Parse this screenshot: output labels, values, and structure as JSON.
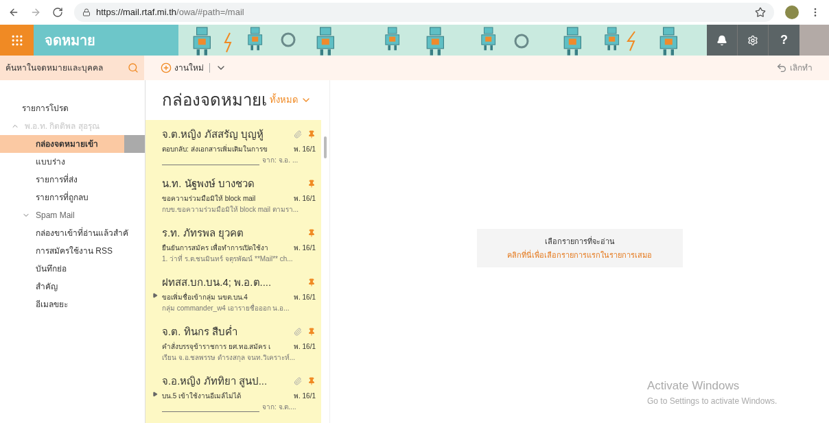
{
  "browser": {
    "url_host": "https://mail.rtaf.mi.th",
    "url_path": "/owa/#path=/mail"
  },
  "header": {
    "app_title": "จดหมาย",
    "help_label": "?"
  },
  "search": {
    "placeholder": "ค้นหาในจดหมายและบุคคล"
  },
  "commands": {
    "new": "งานใหม่",
    "undo": "เลิกทำ"
  },
  "sidebar": {
    "favorites": "รายการโปรด",
    "account": {
      "name": "พ.อ.ท. กิตติพล สุอรุณ",
      "expanded": true
    },
    "items": [
      {
        "label": "กล่องจดหมายเข้า",
        "selected": true,
        "kind": "folder"
      },
      {
        "label": "แบบร่าง",
        "selected": false,
        "kind": "folder"
      },
      {
        "label": "รายการที่ส่ง",
        "selected": false,
        "kind": "folder"
      },
      {
        "label": "รายการที่ถูกลบ",
        "selected": false,
        "kind": "folder"
      },
      {
        "label": "Spam Mail",
        "selected": false,
        "kind": "group",
        "expanded": true
      },
      {
        "label": "กล่องขาเข้าที่อ่านแล้วสำคั",
        "selected": false,
        "kind": "folder"
      },
      {
        "label": "การสมัครใช้งาน RSS",
        "selected": false,
        "kind": "folder"
      },
      {
        "label": "บันทึกย่อ",
        "selected": false,
        "kind": "folder"
      },
      {
        "label": "สำคัญ",
        "selected": false,
        "kind": "folder"
      },
      {
        "label": "อีเมลขยะ",
        "selected": false,
        "kind": "folder"
      }
    ]
  },
  "list": {
    "title": "กล่องจดหมายเ",
    "filter": "ทั้งหมด",
    "messages": [
      {
        "sender": "จ.ต.หญิง ภัสสรัญ บุญหู้",
        "subject": "ตอบกลับ: ส่งเอกสารเพิ่มเติมในการข",
        "date": "พ. 16/1",
        "preview": "จาก: จ.อ. ...",
        "preview_rule": true,
        "attachment": true,
        "pinned": true,
        "thread": false
      },
      {
        "sender": "น.ท. นัฐพงษ์ บางชวด",
        "subject": "ขอความร่วมมือมิให้ block mail",
        "date": "พ. 16/1",
        "preview": "กบข.ขอความร่วมมือมิให้ block mail ตามรา...",
        "preview_rule": false,
        "attachment": false,
        "pinned": true,
        "thread": false
      },
      {
        "sender": "ร.ท. ภัทรพล ยุวคต",
        "subject": "ยืนยันการสมัคร เพื่อทำการเปิดใช้งา",
        "date": "พ. 16/1",
        "preview": "1. ว่าที่ ร.ต.ชนมินทร์ จตุรพัฒน์ **Mail** ch...",
        "preview_rule": false,
        "attachment": false,
        "pinned": true,
        "thread": false
      },
      {
        "sender": "ฝทสส.บก.บน.4; พ.อ.ต....",
        "subject": "ขอเพิ่มชื่อเข้ากลุ่ม นขต.บน.4",
        "date": "พ. 16/1",
        "preview": "กลุ่ม commander_w4  เอารายชื่อออก  น.อ...",
        "preview_rule": false,
        "attachment": false,
        "pinned": true,
        "thread": true
      },
      {
        "sender": "จ.ต. ทินกร สืบค่ำ",
        "subject": "คำสั่งบรรจุข้าราชการ ยศ.ทอ.สมัคร เ",
        "date": "พ. 16/1",
        "preview": "เรียน จ.อ.ชลพรรษ ดำรงสกุล จนท.วิเคราะห์...",
        "preview_rule": false,
        "attachment": true,
        "pinned": true,
        "thread": false
      },
      {
        "sender": "จ.อ.หญิง ภัททิยา สูนป...",
        "subject": "บน.5 เข้าใช้งานอีเมล์ไม่ได้",
        "date": "พ. 16/1",
        "preview": "จาก: จ.ต....",
        "preview_rule": true,
        "attachment": true,
        "pinned": true,
        "thread": true
      }
    ]
  },
  "reading_pane": {
    "title": "เลือกรายการที่จะอ่าน",
    "link": "คลิกที่นี่เพื่อเลือกรายการแรกในรายการเสมอ"
  },
  "activation": {
    "title": "Activate Windows",
    "text": "Go to Settings to activate Windows."
  }
}
